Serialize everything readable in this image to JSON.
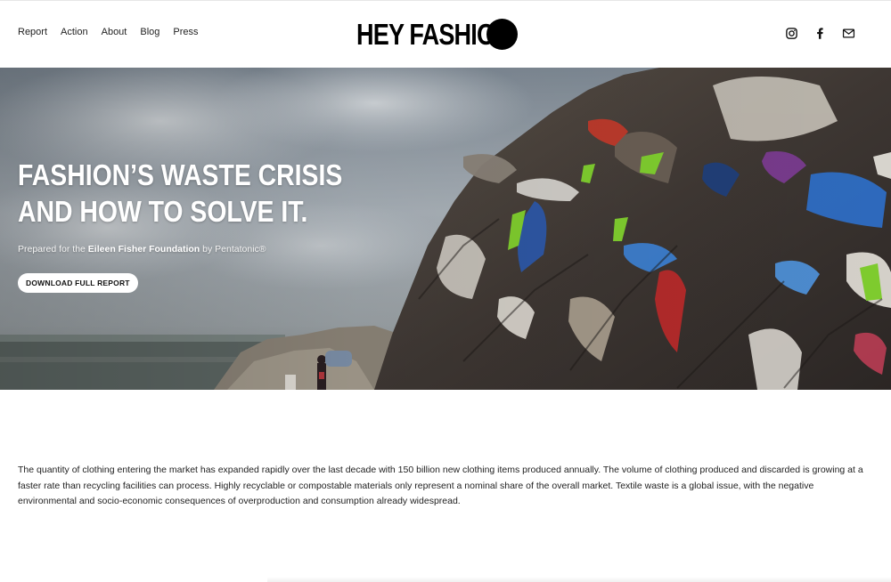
{
  "nav": {
    "items": [
      {
        "label": "Report"
      },
      {
        "label": "Action"
      },
      {
        "label": "About"
      },
      {
        "label": "Blog"
      },
      {
        "label": "Press"
      }
    ]
  },
  "logo": {
    "text": "HEY FASHION"
  },
  "social": {
    "icons": [
      "instagram-icon",
      "facebook-icon",
      "email-icon"
    ]
  },
  "hero": {
    "title_line1": "FASHION’S WASTE CRISIS",
    "title_line2": "AND HOW TO SOLVE IT.",
    "subtitle_prefix": "Prepared for the ",
    "subtitle_org": "Eileen Fisher Foundation",
    "subtitle_suffix": " by Pentatonic®",
    "button_label": "DOWNLOAD FULL REPORT"
  },
  "intro": {
    "paragraph": "The quantity of clothing entering the market has expanded rapidly over the last decade with 150 billion new clothing items produced annually. The volume of clothing produced and discarded is growing at a faster rate than recycling facilities can process. Highly recyclable or compostable materials only represent a nominal share of the overall market. Textile waste is a global issue, with the negative environmental and socio-economic consequences of overproduction and consumption already widespread."
  },
  "colors": {
    "background": "#ffffff",
    "text": "#111111",
    "hero_text": "#ffffff",
    "button_bg": "#ffffff"
  }
}
